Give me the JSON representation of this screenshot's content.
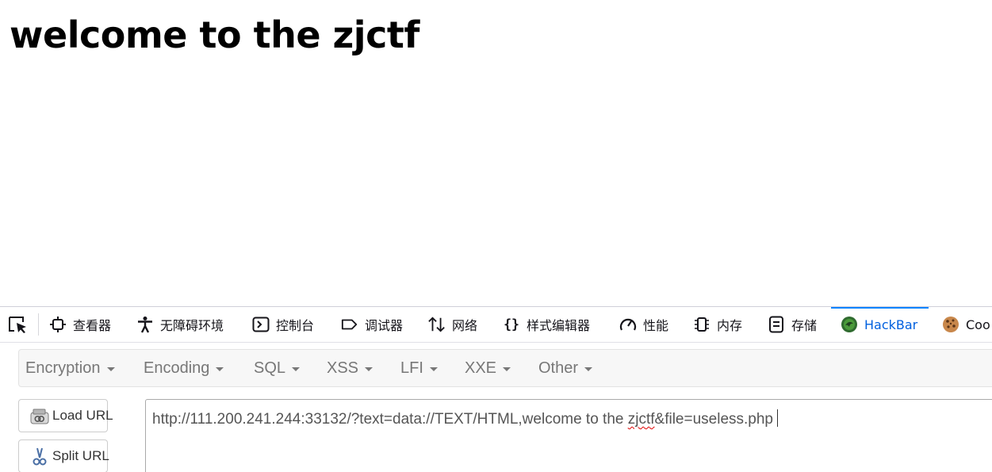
{
  "page": {
    "heading": "welcome to the zjctf"
  },
  "devtools": {
    "tabs": [
      {
        "label": "查看器",
        "icon": "inspector-icon"
      },
      {
        "label": "无障碍环境",
        "icon": "accessibility-icon"
      },
      {
        "label": "控制台",
        "icon": "console-icon"
      },
      {
        "label": "调试器",
        "icon": "debugger-icon"
      },
      {
        "label": "网络",
        "icon": "network-icon"
      },
      {
        "label": "样式编辑器",
        "icon": "style-editor-icon"
      },
      {
        "label": "性能",
        "icon": "performance-icon"
      },
      {
        "label": "内存",
        "icon": "memory-icon"
      },
      {
        "label": "存储",
        "icon": "storage-icon"
      },
      {
        "label": "HackBar",
        "icon": "hackbar-icon",
        "active": true
      },
      {
        "label": "Coo",
        "icon": "cookie-icon"
      }
    ],
    "accent_color": "#0a84ff"
  },
  "hackbar": {
    "menus": [
      "Encryption",
      "Encoding",
      "SQL",
      "XSS",
      "LFI",
      "XXE",
      "Other"
    ],
    "buttons": {
      "load_url": "Load URL",
      "split_url": "Split URL"
    },
    "url": {
      "before": "http://111.200.241.244:33132/?text=data://TEXT/HTML,welcome to the ",
      "misspelled": "zjctf",
      "after": "&file=useless.php"
    }
  }
}
